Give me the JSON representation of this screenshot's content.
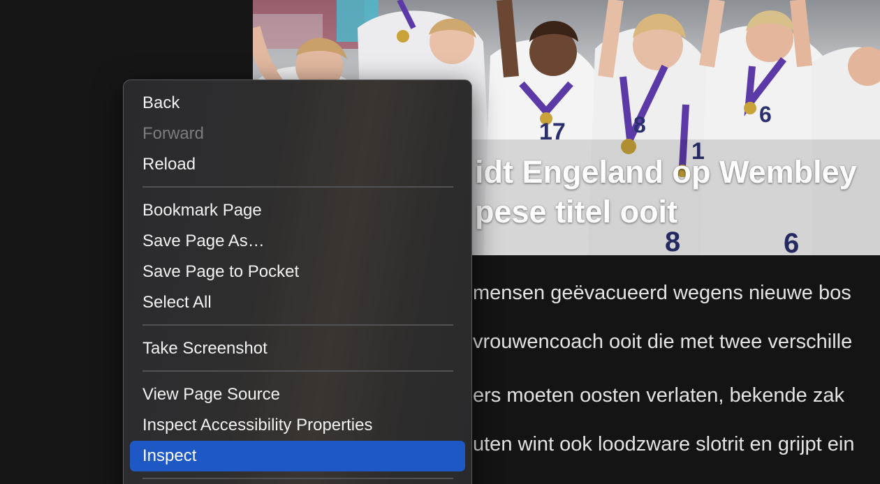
{
  "article": {
    "title_line1": "idt Engeland op Wembley",
    "title_line2": "pese titel ooit",
    "headlines": [
      "mensen geëvacueerd wegens nieuwe bos",
      "vrouwencoach ooit die met twee verschille",
      "ers moeten oosten verlaten, bekende zak",
      "uten wint ook loodzware slotrit en grijpt ein"
    ]
  },
  "context_menu": {
    "items": {
      "back": "Back",
      "forward": "Forward",
      "reload": "Reload",
      "bookmark_page": "Bookmark Page",
      "save_page_as": "Save Page As…",
      "save_to_pocket": "Save Page to Pocket",
      "select_all": "Select All",
      "take_screenshot": "Take Screenshot",
      "view_page_source": "View Page Source",
      "inspect_accessibility": "Inspect Accessibility Properties",
      "inspect": "Inspect"
    },
    "states": {
      "forward": "disabled",
      "inspect": "highlighted"
    },
    "colors": {
      "highlight": "#1d58c4",
      "disabled_text": "#7c7c7e"
    }
  }
}
